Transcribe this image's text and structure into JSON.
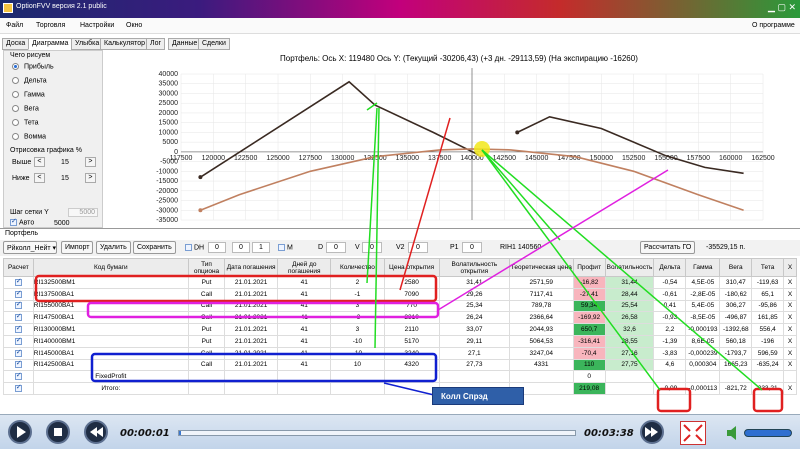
{
  "window": {
    "title": "OptionFVV версия 2.1 public",
    "about": "О программе"
  },
  "menu": [
    "Файл",
    "Торговля",
    "Настройки",
    "Окно"
  ],
  "tabs": [
    "Доска",
    "Диаграмма",
    "Улыбка",
    "Калькулятор",
    "Лог",
    "Данные",
    "Сделки"
  ],
  "active_tab": "Диаграмма",
  "left_panel": {
    "what_draw_label": "Чего рисуем",
    "options": [
      "Прибыль",
      "Дельта",
      "Гамма",
      "Вега",
      "Тета",
      "Вомма"
    ],
    "selected": "Прибыль",
    "draw_pct_label": "Отрисовка графика %",
    "above_label": "Выше",
    "above_value": "15",
    "below_label": "Ниже",
    "below_value": "15",
    "grid_label": "Шаг сетки Y",
    "grid_value": "5000",
    "auto_label": "Авто",
    "auto_value": "5000"
  },
  "chart": {
    "title": "Портфель: Ось X: 119480 Ось Y: (Текущий -30206,43) (+3 дн. -29113,59) (На экспирацию -16260)"
  },
  "chart_data": {
    "type": "line",
    "x_ticks": [
      "117500",
      "120000",
      "122500",
      "125000",
      "127500",
      "130000",
      "132500",
      "135000",
      "137500",
      "140000",
      "142500",
      "145000",
      "147500",
      "150000",
      "152500",
      "155000",
      "157500",
      "160000",
      "162500"
    ],
    "y_ticks": [
      "40000",
      "35000",
      "30000",
      "25000",
      "20000",
      "15000",
      "10000",
      "5000",
      "0",
      "-5000",
      "-10000",
      "-15000",
      "-20000",
      "-25000",
      "-30000",
      "-35000"
    ],
    "xlim": [
      117500,
      162500
    ],
    "ylim": [
      -35000,
      40000
    ],
    "series": [
      {
        "color": "#3a2a22",
        "x": [
          119000,
          130500,
          132500,
          137000,
          140500
        ],
        "y": [
          -13000,
          36000,
          24000,
          10000,
          -1500
        ]
      },
      {
        "color": "#3a2a22",
        "x": [
          143500,
          146000,
          150000,
          155000,
          158000,
          161000
        ],
        "y": [
          10000,
          18000,
          12000,
          -2000,
          -8000,
          -11000
        ]
      },
      {
        "color": "#c08060",
        "x": [
          119000,
          122000,
          127500,
          132500,
          137500,
          140000,
          143000,
          148000,
          152500,
          157500,
          161000
        ],
        "y": [
          -30000,
          -22000,
          -10000,
          -2500,
          1000,
          1500,
          1000,
          -2500,
          -10000,
          -22000,
          -30000
        ]
      }
    ]
  },
  "portfolio": {
    "section_label": "Портфель",
    "select_value": "Рйколл_Нейт",
    "import": "Импорт",
    "delete": "Удалить",
    "save": "Сохранить",
    "dh_label": "DH",
    "dh_value": "0",
    "s1": "0",
    "s2": "1",
    "m_label": "M",
    "d_label": "D",
    "d_value": "0",
    "v_label": "V",
    "v_value": "0",
    "v2_label": "V2",
    "v2_value": "0",
    "p1_label": "P1",
    "p1_value": "0",
    "rih": "RIH1 140560",
    "calc_go": "Рассчитать ГО",
    "go_value": "-35529,15 п."
  },
  "table": {
    "headers": [
      "Расчет",
      "Код бумаги",
      "Тип опциона",
      "Дата погашения",
      "Дней до погашения",
      "Количество",
      "Цена открытия",
      "Волатильность открытия",
      "Теоретическая цена",
      "Профит",
      "Волатильность",
      "Дельта",
      "Гамма",
      "Вега",
      "Тета",
      "X"
    ],
    "rows": [
      [
        "✓",
        "RI132500BM1",
        "Put",
        "21.01.2021",
        "41",
        "2",
        "2580",
        "31,41",
        "2571,59",
        "-16,82",
        "31,44",
        "-0,54",
        "4,5E-05",
        "310,47",
        "-119,63",
        "X"
      ],
      [
        "✓",
        "RI137500BA1",
        "Call",
        "21.01.2021",
        "41",
        "-1",
        "7090",
        "29,26",
        "7117,41",
        "-27,41",
        "28,44",
        "-0,61",
        "-2,8E-05",
        "-180,62",
        "65,1",
        "X"
      ],
      [
        "✓",
        "RI155000BA1",
        "Call",
        "21.01.2021",
        "41",
        "3",
        "770",
        "25,34",
        "789,78",
        "59,34",
        "25,54",
        "0,41",
        "5,4E-05",
        "306,27",
        "-95,86",
        "X"
      ],
      [
        "✓",
        "RI147500BA1",
        "Call",
        "21.01.2021",
        "41",
        "-3",
        "2310",
        "26,24",
        "2366,64",
        "-169,92",
        "26,58",
        "-0,93",
        "-8,5E-05",
        "-496,87",
        "161,85",
        "X"
      ],
      [
        "✓",
        "RI130000BM1",
        "Put",
        "21.01.2021",
        "41",
        "3",
        "2110",
        "33,07",
        "2044,93",
        "650,7",
        "32,6",
        "2,2",
        "-0,000193",
        "-1392,68",
        "556,4",
        "X"
      ],
      [
        "✓",
        "RI140000BM1",
        "Put",
        "21.01.2021",
        "41",
        "-10",
        "5170",
        "29,11",
        "5064,53",
        "-316,41",
        "28,55",
        "-1,39",
        "8,6E-05",
        "560,18",
        "-196",
        "X"
      ],
      [
        "✓",
        "RI145000BA1",
        "Call",
        "21.01.2021",
        "41",
        "-10",
        "3240",
        "27,1",
        "3247,04",
        "-70,4",
        "27,16",
        "-3,83",
        "-0,000239",
        "-1793,7",
        "596,59",
        "X"
      ],
      [
        "✓",
        "RI142500BA1",
        "Call",
        "21.01.2021",
        "41",
        "10",
        "4320",
        "27,73",
        "4331",
        "110",
        "27,75",
        "4,6",
        "0,000304",
        "1665,23",
        "-635,24",
        "X"
      ]
    ],
    "fixed_profit_label": "FixedProfit",
    "fixed_profit_value": "0",
    "total_label": "Итого:",
    "total_profit": "219,08",
    "total_delta": "-0,09",
    "total_gamma": "-0,000113",
    "total_vega": "-821,72",
    "total_theta": "333,21",
    "close": "X"
  },
  "annotation": {
    "label": "Колл Спрэд"
  },
  "player": {
    "elapsed": "00:00:01",
    "total": "00:03:38",
    "progress_fraction": 0.005
  }
}
